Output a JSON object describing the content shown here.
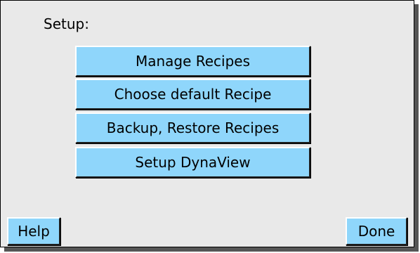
{
  "setup": {
    "title": "Setup:"
  },
  "menu": {
    "items": [
      {
        "label": "Manage Recipes"
      },
      {
        "label": "Choose default Recipe"
      },
      {
        "label": "Backup, Restore Recipes"
      },
      {
        "label": "Setup DynaView"
      }
    ]
  },
  "footer": {
    "help_label": "Help",
    "done_label": "Done"
  },
  "colors": {
    "button_fill": "#8fd6fb",
    "panel_background": "#e9e9e9"
  }
}
